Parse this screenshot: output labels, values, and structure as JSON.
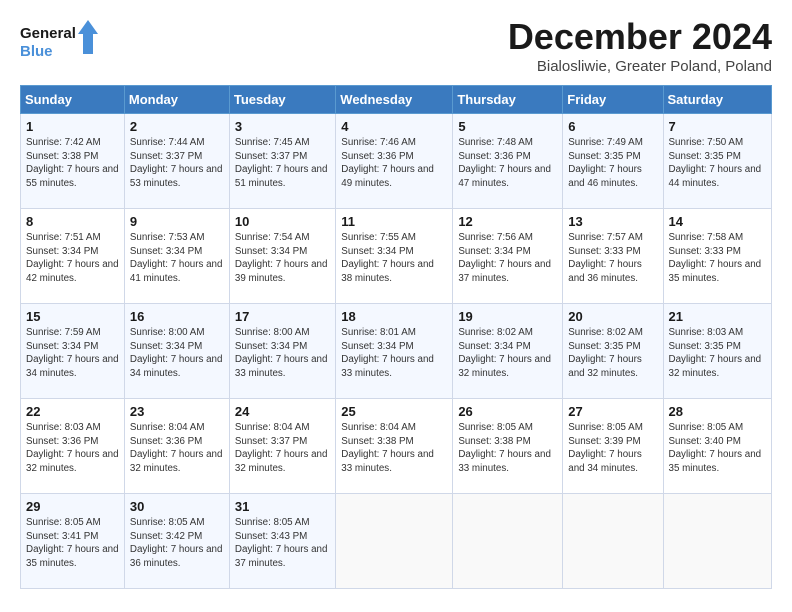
{
  "header": {
    "logo_line1": "General",
    "logo_line2": "Blue",
    "title": "December 2024",
    "subtitle": "Bialosliwie, Greater Poland, Poland"
  },
  "weekdays": [
    "Sunday",
    "Monday",
    "Tuesday",
    "Wednesday",
    "Thursday",
    "Friday",
    "Saturday"
  ],
  "weeks": [
    [
      {
        "day": "1",
        "sunrise": "7:42 AM",
        "sunset": "3:38 PM",
        "daylight": "7 hours and 55 minutes."
      },
      {
        "day": "2",
        "sunrise": "7:44 AM",
        "sunset": "3:37 PM",
        "daylight": "7 hours and 53 minutes."
      },
      {
        "day": "3",
        "sunrise": "7:45 AM",
        "sunset": "3:37 PM",
        "daylight": "7 hours and 51 minutes."
      },
      {
        "day": "4",
        "sunrise": "7:46 AM",
        "sunset": "3:36 PM",
        "daylight": "7 hours and 49 minutes."
      },
      {
        "day": "5",
        "sunrise": "7:48 AM",
        "sunset": "3:36 PM",
        "daylight": "7 hours and 47 minutes."
      },
      {
        "day": "6",
        "sunrise": "7:49 AM",
        "sunset": "3:35 PM",
        "daylight": "7 hours and 46 minutes."
      },
      {
        "day": "7",
        "sunrise": "7:50 AM",
        "sunset": "3:35 PM",
        "daylight": "7 hours and 44 minutes."
      }
    ],
    [
      {
        "day": "8",
        "sunrise": "7:51 AM",
        "sunset": "3:34 PM",
        "daylight": "7 hours and 42 minutes."
      },
      {
        "day": "9",
        "sunrise": "7:53 AM",
        "sunset": "3:34 PM",
        "daylight": "7 hours and 41 minutes."
      },
      {
        "day": "10",
        "sunrise": "7:54 AM",
        "sunset": "3:34 PM",
        "daylight": "7 hours and 39 minutes."
      },
      {
        "day": "11",
        "sunrise": "7:55 AM",
        "sunset": "3:34 PM",
        "daylight": "7 hours and 38 minutes."
      },
      {
        "day": "12",
        "sunrise": "7:56 AM",
        "sunset": "3:34 PM",
        "daylight": "7 hours and 37 minutes."
      },
      {
        "day": "13",
        "sunrise": "7:57 AM",
        "sunset": "3:33 PM",
        "daylight": "7 hours and 36 minutes."
      },
      {
        "day": "14",
        "sunrise": "7:58 AM",
        "sunset": "3:33 PM",
        "daylight": "7 hours and 35 minutes."
      }
    ],
    [
      {
        "day": "15",
        "sunrise": "7:59 AM",
        "sunset": "3:34 PM",
        "daylight": "7 hours and 34 minutes."
      },
      {
        "day": "16",
        "sunrise": "8:00 AM",
        "sunset": "3:34 PM",
        "daylight": "7 hours and 34 minutes."
      },
      {
        "day": "17",
        "sunrise": "8:00 AM",
        "sunset": "3:34 PM",
        "daylight": "7 hours and 33 minutes."
      },
      {
        "day": "18",
        "sunrise": "8:01 AM",
        "sunset": "3:34 PM",
        "daylight": "7 hours and 33 minutes."
      },
      {
        "day": "19",
        "sunrise": "8:02 AM",
        "sunset": "3:34 PM",
        "daylight": "7 hours and 32 minutes."
      },
      {
        "day": "20",
        "sunrise": "8:02 AM",
        "sunset": "3:35 PM",
        "daylight": "7 hours and 32 minutes."
      },
      {
        "day": "21",
        "sunrise": "8:03 AM",
        "sunset": "3:35 PM",
        "daylight": "7 hours and 32 minutes."
      }
    ],
    [
      {
        "day": "22",
        "sunrise": "8:03 AM",
        "sunset": "3:36 PM",
        "daylight": "7 hours and 32 minutes."
      },
      {
        "day": "23",
        "sunrise": "8:04 AM",
        "sunset": "3:36 PM",
        "daylight": "7 hours and 32 minutes."
      },
      {
        "day": "24",
        "sunrise": "8:04 AM",
        "sunset": "3:37 PM",
        "daylight": "7 hours and 32 minutes."
      },
      {
        "day": "25",
        "sunrise": "8:04 AM",
        "sunset": "3:38 PM",
        "daylight": "7 hours and 33 minutes."
      },
      {
        "day": "26",
        "sunrise": "8:05 AM",
        "sunset": "3:38 PM",
        "daylight": "7 hours and 33 minutes."
      },
      {
        "day": "27",
        "sunrise": "8:05 AM",
        "sunset": "3:39 PM",
        "daylight": "7 hours and 34 minutes."
      },
      {
        "day": "28",
        "sunrise": "8:05 AM",
        "sunset": "3:40 PM",
        "daylight": "7 hours and 35 minutes."
      }
    ],
    [
      {
        "day": "29",
        "sunrise": "8:05 AM",
        "sunset": "3:41 PM",
        "daylight": "7 hours and 35 minutes."
      },
      {
        "day": "30",
        "sunrise": "8:05 AM",
        "sunset": "3:42 PM",
        "daylight": "7 hours and 36 minutes."
      },
      {
        "day": "31",
        "sunrise": "8:05 AM",
        "sunset": "3:43 PM",
        "daylight": "7 hours and 37 minutes."
      },
      null,
      null,
      null,
      null
    ]
  ],
  "labels": {
    "sunrise": "Sunrise:",
    "sunset": "Sunset:",
    "daylight": "Daylight:"
  }
}
